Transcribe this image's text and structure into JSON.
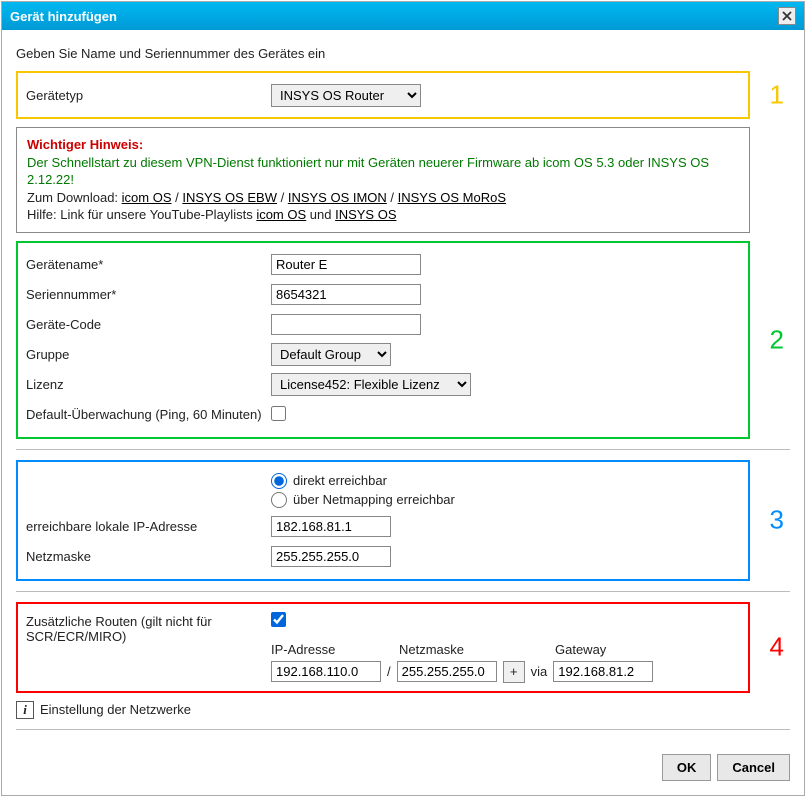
{
  "title": "Gerät hinzufügen",
  "intro": "Geben Sie Name und Seriennummer des Gerätes ein",
  "sectionNumbers": {
    "s1": "1",
    "s2": "2",
    "s3": "3",
    "s4": "4"
  },
  "typ": {
    "label": "Gerätetyp",
    "selected": "INSYS OS Router"
  },
  "hint": {
    "title": "Wichtiger Hinweis:",
    "line1": "Der Schnellstart zu diesem VPN-Dienst funktioniert nur mit Geräten neuerer Firmware ab icom OS 5.3 oder INSYS OS 2.12.22!",
    "dl_prefix": "Zum Download: ",
    "dl1": "icom OS",
    "dl2": "INSYS OS EBW",
    "dl3": "INSYS OS IMON",
    "dl4": "INSYS OS MoRoS",
    "help_prefix": "Hilfe: Link für unsere YouTube-Playlists ",
    "help1": "icom OS",
    "help_und": " und ",
    "help2": "INSYS OS"
  },
  "fields": {
    "name_label": "Gerätename*",
    "name_value": "Router E",
    "serial_label": "Seriennummer*",
    "serial_value": "8654321",
    "code_label": "Geräte-Code",
    "code_value": "",
    "group_label": "Gruppe",
    "group_selected": "Default Group",
    "license_label": "Lizenz",
    "license_selected": "License452: Flexible Lizenz",
    "monitor_label": "Default-Überwachung (Ping, 60 Minuten)"
  },
  "reach": {
    "direct": "direkt erreichbar",
    "netmap": "über Netmapping erreichbar",
    "ip_label": "erreichbare lokale IP-Adresse",
    "ip_value": "182.168.81.1",
    "mask_label": "Netzmaske",
    "mask_value": "255.255.255.0"
  },
  "routes": {
    "label": "Zusätzliche Routen (gilt nicht für SCR/ECR/MIRO)",
    "hdr_ip": "IP-Adresse",
    "hdr_mask": "Netzmaske",
    "hdr_gw": "Gateway",
    "ip": "192.168.110.0",
    "mask": "255.255.255.0",
    "gw": "192.168.81.2",
    "slash": "/",
    "via": "via",
    "plus": "+"
  },
  "netset": "Einstellung der Netzwerke",
  "buttons": {
    "ok": "OK",
    "cancel": "Cancel"
  }
}
